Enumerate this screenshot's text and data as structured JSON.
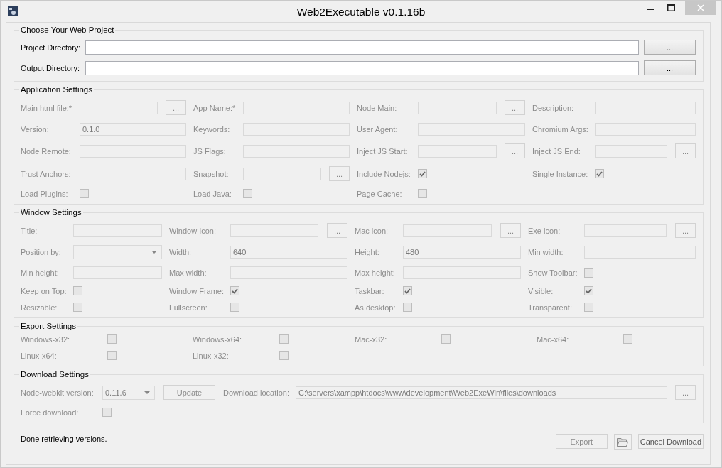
{
  "window": {
    "title": "Web2Executable v0.1.16b"
  },
  "sections": [
    {
      "title": "Choose Your Web Project",
      "kind": "project",
      "disabled": false,
      "rows": [
        [
          {
            "kind": "text",
            "label": "Project Directory:",
            "browse": "..."
          }
        ],
        [
          {
            "kind": "text",
            "label": "Output Directory:",
            "browse": "..."
          }
        ]
      ]
    },
    {
      "title": "Application Settings",
      "kind": "app",
      "disabled": true,
      "rows": [
        [
          {
            "kind": "text",
            "label": "Main html file:*",
            "browse": "..."
          },
          {
            "kind": "text",
            "label": "App Name:*"
          },
          {
            "kind": "text",
            "label": "Node Main:",
            "browse": "..."
          },
          {
            "kind": "text",
            "label": "Description:"
          }
        ],
        [
          {
            "kind": "text",
            "label": "Version:",
            "value": "0.1.0"
          },
          {
            "kind": "text",
            "label": "Keywords:"
          },
          {
            "kind": "text",
            "label": "User Agent:"
          },
          {
            "kind": "text",
            "label": "Chromium Args:"
          }
        ],
        [
          {
            "kind": "text",
            "label": "Node Remote:"
          },
          {
            "kind": "text",
            "label": "JS Flags:"
          },
          {
            "kind": "text",
            "label": "Inject JS Start:",
            "browse": "..."
          },
          {
            "kind": "text",
            "label": "Inject JS End:",
            "browse": "..."
          }
        ],
        [
          {
            "kind": "text",
            "label": "Trust Anchors:"
          },
          {
            "kind": "text",
            "label": "Snapshot:",
            "browse": "..."
          },
          {
            "kind": "check",
            "label": "Include Nodejs:",
            "checked": true
          },
          {
            "kind": "check",
            "label": "Single Instance:",
            "checked": true
          }
        ],
        [
          {
            "kind": "check",
            "label": "Load Plugins:",
            "checked": false
          },
          {
            "kind": "check",
            "label": "Load Java:",
            "checked": false
          },
          {
            "kind": "check",
            "label": "Page Cache:",
            "checked": false
          }
        ]
      ]
    },
    {
      "title": "Window Settings",
      "kind": "window",
      "disabled": true,
      "rows": [
        [
          {
            "kind": "text",
            "label": "Title:"
          },
          {
            "kind": "text",
            "label": "Window Icon:",
            "browse": "..."
          },
          {
            "kind": "text",
            "label": "Mac icon:",
            "browse": "..."
          },
          {
            "kind": "text",
            "label": "Exe icon:",
            "browse": "..."
          }
        ],
        [
          {
            "kind": "select",
            "label": "Position by:"
          },
          {
            "kind": "text",
            "label": "Width:",
            "value": "640"
          },
          {
            "kind": "text",
            "label": "Height:",
            "value": "480"
          },
          {
            "kind": "text",
            "label": "Min width:"
          }
        ],
        [
          {
            "kind": "text",
            "label": "Min height:"
          },
          {
            "kind": "text",
            "label": "Max width:"
          },
          {
            "kind": "text",
            "label": "Max height:"
          },
          {
            "kind": "check",
            "label": "Show Toolbar:",
            "checked": false
          }
        ],
        [
          {
            "kind": "check",
            "label": "Keep on Top:",
            "checked": false
          },
          {
            "kind": "check",
            "label": "Window Frame:",
            "checked": true
          },
          {
            "kind": "check",
            "label": "Taskbar:",
            "checked": true
          },
          {
            "kind": "check",
            "label": "Visible:",
            "checked": true
          }
        ],
        [
          {
            "kind": "check",
            "label": "Resizable:",
            "checked": false
          },
          {
            "kind": "check",
            "label": "Fullscreen:",
            "checked": false
          },
          {
            "kind": "check",
            "label": "As desktop:",
            "checked": false
          },
          {
            "kind": "check",
            "label": "Transparent:",
            "checked": false
          }
        ]
      ]
    },
    {
      "title": "Export Settings",
      "kind": "export",
      "disabled": true,
      "rows": [
        [
          {
            "kind": "check",
            "label": "Windows-x32:",
            "checked": false
          },
          {
            "kind": "check",
            "label": "Windows-x64:",
            "checked": false
          },
          {
            "kind": "check",
            "label": "Mac-x32:",
            "checked": false
          },
          {
            "kind": "check",
            "label": "Mac-x64:",
            "checked": false
          }
        ],
        [
          {
            "kind": "check",
            "label": "Linux-x64:",
            "checked": false
          },
          {
            "kind": "check",
            "label": "Linux-x32:",
            "checked": false
          }
        ]
      ]
    },
    {
      "title": "Download Settings",
      "kind": "download",
      "disabled": true,
      "rows": [
        [
          {
            "kind": "select",
            "label": "Node-webkit version:",
            "value": "0.11.6"
          },
          {
            "kind": "button",
            "label": "Update"
          },
          {
            "kind": "text",
            "label": "Download location:",
            "value": "C:\\servers\\xampp\\htdocs\\www\\development\\Web2ExeWin\\files\\downloads",
            "browse": "..."
          }
        ],
        [
          {
            "kind": "check",
            "label": "Force download:",
            "checked": false
          }
        ]
      ]
    }
  ],
  "status": "Done retrieving versions.",
  "buttons": [
    {
      "kind": "text",
      "label": "Export",
      "disabled": true
    },
    {
      "kind": "folder",
      "disabled": false
    },
    {
      "kind": "text",
      "label": "Cancel Download",
      "disabled": false
    }
  ]
}
